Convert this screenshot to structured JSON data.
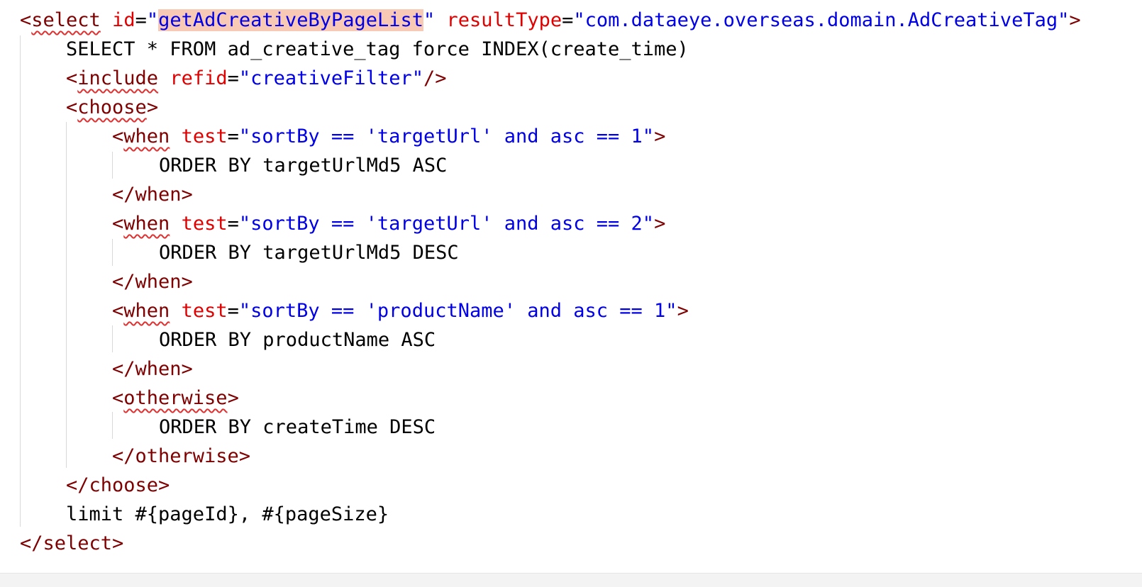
{
  "editor": {
    "lines": {
      "l1": {
        "open": "<",
        "tag": "select",
        "attr1": "id",
        "eq1": "=",
        "q1a": "\"",
        "val1": "getAdCreativeByPageList",
        "q1b": "\"",
        "attr2": "resultType",
        "eq2": "=",
        "val2": "\"com.dataeye.overseas.domain.AdCreativeTag\"",
        "close": ">"
      },
      "l2": {
        "text": "SELECT * FROM ad_creative_tag force INDEX(create_time)"
      },
      "l3": {
        "open": "<",
        "tag": "include",
        "attr": "refid",
        "eq": "=",
        "val": "\"creativeFilter\"",
        "close": "/>"
      },
      "l4": {
        "open": "<",
        "tag": "choose",
        "close": ">"
      },
      "l5": {
        "open": "<",
        "tag": "when",
        "attr": "test",
        "eq": "=",
        "val": "\"sortBy == 'targetUrl' and asc == 1\"",
        "close": ">"
      },
      "l6": {
        "text": "ORDER BY targetUrlMd5 ASC"
      },
      "l7": {
        "tag": "</when>"
      },
      "l8": {
        "open": "<",
        "tag": "when",
        "attr": "test",
        "eq": "=",
        "val": "\"sortBy == 'targetUrl' and asc == 2\"",
        "close": ">"
      },
      "l9": {
        "text": "ORDER BY targetUrlMd5 DESC"
      },
      "l10": {
        "tag": "</when>"
      },
      "l11": {
        "open": "<",
        "tag": "when",
        "attr": "test",
        "eq": "=",
        "val": "\"sortBy == 'productName' and asc == 1\"",
        "close": ">"
      },
      "l12": {
        "text": "ORDER BY productName ASC"
      },
      "l13": {
        "tag": "</when>"
      },
      "l14": {
        "open": "<",
        "tag": "otherwise",
        "close": ">"
      },
      "l15": {
        "text": "ORDER BY createTime DESC"
      },
      "l16": {
        "tag": "</otherwise>"
      },
      "l17": {
        "tag": "</choose>"
      },
      "l18": {
        "text": "limit #{pageId}, #{pageSize}"
      },
      "l19": {
        "tag": "</select>"
      }
    }
  }
}
